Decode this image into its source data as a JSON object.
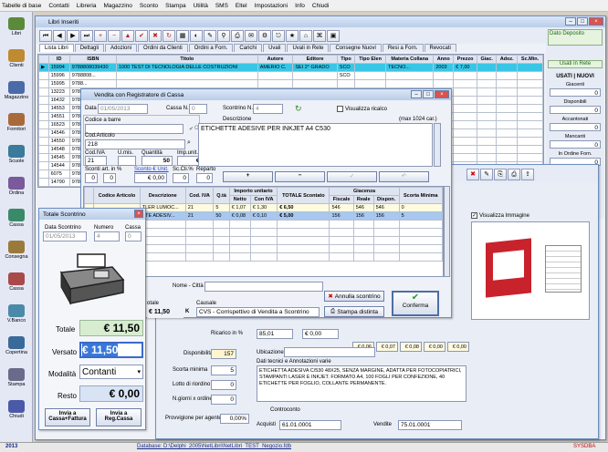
{
  "menu": [
    "Tabelle di base",
    "Contatti",
    "Libreria",
    "Magazzino",
    "Sconto",
    "Stampa",
    "Utilità",
    "SMS",
    "Eltel",
    "Impostazioni",
    "Info",
    "Chiudi"
  ],
  "sidebar": [
    "Libri",
    "Clienti",
    "Magazzino",
    "Fornitori",
    "Scuole",
    "Ordina",
    "Cassa",
    "Consegna",
    "Cassa",
    "V.Banco",
    "Copertina",
    "Stampa",
    "Chiudi"
  ],
  "status": {
    "year": "2013",
    "db": "Database: D:\\Delphi_2005\\NetLibri\\NetLibri_TEST_Negozio.fdb",
    "brand": "SYSDBA"
  },
  "libri": {
    "title": "Libri Inseriti",
    "tabs": [
      "Lista Libri",
      "Dettagli",
      "Adozioni",
      "Ordini da Clienti",
      "Ordini a Forn.",
      "Carichi",
      "Uvali",
      "Uvali in Rete",
      "Consegne Nuovi",
      "Resi a Forn.",
      "Revocati"
    ],
    "cols": [
      "ID",
      "ISBN",
      "Titolo",
      "Autore",
      "Editore",
      "Tipo",
      "Tipo Elen",
      "Materia Collana",
      "Anno",
      "Prezzo",
      "Giac.",
      "Adoz.",
      "Sc.Min."
    ],
    "subcols": [
      "U",
      "N",
      "A",
      "T",
      "U",
      "N",
      "T",
      "AH.",
      "M..."
    ],
    "rows": [
      {
        "id": "15994",
        "isbn": "9788808039430",
        "title": "1000 TEST DI TECNOLOGIA DELLE COSTRUZIONI",
        "author": "AMERIO C.",
        "ed": "SEI 2° GRADO",
        "tipo": "SCO",
        "mat": "TECNO...",
        "anno": "2003",
        "prezzo": "€ 7,00"
      },
      {
        "id": "15996",
        "isbn": "9788808...",
        "title": "",
        "author": "",
        "ed": "",
        "tipo": "SCO",
        "mat": "",
        "anno": "",
        "prezzo": ""
      },
      {
        "id": "15995",
        "isbn": "9788...",
        "title": "",
        "author": "",
        "ed": "",
        "tipo": "",
        "mat": "",
        "anno": "",
        "prezzo": ""
      },
      {
        "id": "13223",
        "isbn": "9788...",
        "title": "",
        "author": "",
        "ed": "",
        "tipo": "",
        "mat": "",
        "anno": "",
        "prezzo": ""
      },
      {
        "id": "16432",
        "isbn": "9788...",
        "title": "",
        "author": "",
        "ed": "",
        "tipo": "",
        "mat": "",
        "anno": "",
        "prezzo": ""
      },
      {
        "id": "14553",
        "isbn": "9788...",
        "title": "",
        "author": "",
        "ed": "",
        "tipo": "",
        "mat": "",
        "anno": "",
        "prezzo": ""
      },
      {
        "id": "14551",
        "isbn": "9788...",
        "title": "",
        "author": "",
        "ed": "",
        "tipo": "",
        "mat": "",
        "anno": "",
        "prezzo": ""
      },
      {
        "id": "16523",
        "isbn": "9788...",
        "title": "",
        "author": "",
        "ed": "",
        "tipo": "",
        "mat": "",
        "anno": "",
        "prezzo": ""
      },
      {
        "id": "14546",
        "isbn": "9788...",
        "title": "",
        "author": "",
        "ed": "",
        "tipo": "",
        "mat": "",
        "anno": "",
        "prezzo": ""
      },
      {
        "id": "14550",
        "isbn": "9788...",
        "title": "",
        "author": "",
        "ed": "",
        "tipo": "",
        "mat": "",
        "anno": "",
        "prezzo": ""
      },
      {
        "id": "14548",
        "isbn": "9788...",
        "title": "",
        "author": "",
        "ed": "",
        "tipo": "",
        "mat": "",
        "anno": "",
        "prezzo": ""
      },
      {
        "id": "14545",
        "isbn": "9788...",
        "title": "",
        "author": "",
        "ed": "",
        "tipo": "",
        "mat": "",
        "anno": "",
        "prezzo": ""
      },
      {
        "id": "14544",
        "isbn": "9788...",
        "title": "",
        "author": "",
        "ed": "",
        "tipo": "",
        "mat": "",
        "anno": "",
        "prezzo": ""
      },
      {
        "id": "6075",
        "isbn": "9788...",
        "title": "",
        "author": "",
        "ed": "",
        "tipo": "",
        "mat": "",
        "anno": "",
        "prezzo": ""
      },
      {
        "id": "14790",
        "isbn": "9788...",
        "title": "",
        "author": "",
        "ed": "",
        "tipo": "",
        "mat": "",
        "anno": "",
        "prezzo": ""
      },
      {
        "id": "14791",
        "isbn": "9788...",
        "title": "",
        "author": "",
        "ed": "",
        "tipo": "",
        "mat": "",
        "anno": "",
        "prezzo": ""
      },
      {
        "id": "14792",
        "isbn": "9788...",
        "title": "",
        "author": "",
        "ed": "",
        "tipo": "",
        "mat": "",
        "anno": "",
        "prezzo": ""
      }
    ]
  },
  "right": {
    "deposito": "Dato Deposito",
    "usati": "Usati in Rete",
    "usati_nuovi": "USATI | NUOVI",
    "giacenti": "Giacenti",
    "disponibili": "Disponibili",
    "accantonati": "Accantonati",
    "mancanti": "Mancanti",
    "in_ordine": "In Ordine Forn.",
    "zero": "0"
  },
  "vendita": {
    "title": "Vendita con Registratore di Cassa",
    "data_lbl": "Data",
    "data": "01/05/2013",
    "cassa_lbl": "Cassa N.",
    "cassa": "0",
    "scontrino_lbl": "Scontrino N.",
    "scontrino": "4",
    "visualizza": "Visualizza ricalco",
    "codice_lbl": "Codice a barre",
    "ok": "Ok",
    "desc_lbl": "Descrizione",
    "max": "(max 1024 car.)",
    "descrizione": "ETICHETTE ADESIVE PER INKJET A4 C530",
    "cod_art_lbl": "Cod.Articolo",
    "cod_art": "218",
    "cod_iva_lbl": "Cod.IVA",
    "cod_iva": "21",
    "um_lbl": "U.mis.",
    "qta_lbl": "Quantità",
    "qta": "50",
    "imp_lbl": "Imp.unit.con IVA",
    "imp": "€ 0,10",
    "sc_art_lbl": "Sconti art. in %",
    "sc1": "0",
    "sc2": "0",
    "sc_unit_lbl": "Sconto € Unit.",
    "sc_unit": "€ 0,00",
    "sc_cli_lbl": "Sc.Cli.%",
    "sc_cli": "0",
    "reparto_lbl": "Reparto",
    "reparto": "0",
    "grid_cols": [
      "Codice Articolo",
      "Descrizione",
      "Cod. IVA",
      "Q.tà",
      "Netto",
      "Con IVA",
      "TOTALE Scontato",
      "Fiscale",
      "Reale",
      "Dispon.",
      "Scorta Minima"
    ],
    "grid_groups": {
      "importo": "Importo unitario",
      "giacenza": "Giacenza"
    },
    "grid_rows": [
      {
        "code": "",
        "desc": "TLER LUMOC...",
        "iva": "21",
        "q": "5",
        "netto": "€ 1,07",
        "con": "€ 1,30",
        "tot": "€ 6,50",
        "fis": "546",
        "rea": "546",
        "dis": "546",
        "sm": "0"
      },
      {
        "code": "",
        "desc": "TTE ADESIV...",
        "iva": "21",
        "q": "50",
        "netto": "€ 0,08",
        "con": "€ 0,10",
        "tot": "€ 5,00",
        "fis": "156",
        "rea": "156",
        "dis": "156",
        "sm": "5"
      }
    ],
    "nome_lbl": "Nome - Città",
    "tot_lbl": "otale",
    "tot": "€ 11,50",
    "totk": "K",
    "causale_lbl": "Causale",
    "causale": "CVS - Corrispettivo di Vendita a Scontrino",
    "annulla": "Annulla scontrino",
    "stampa": "Stampa distinta",
    "conferma": "Conferma"
  },
  "scontrino": {
    "title": "Totale Scontrino",
    "data_lbl": "Data Scontrino",
    "data": "01/05/2013",
    "num_lbl": "Numero",
    "num": "4",
    "cassa_lbl": "Cassa",
    "cassa": "0",
    "totale_lbl": "Totale",
    "totale": "€ 11,50",
    "versato_lbl": "Versato",
    "versato": "€ 11,50",
    "modalita_lbl": "Modalità",
    "modalita": "Contanti",
    "resto_lbl": "Resto",
    "resto": "€ 0,00",
    "btn1": "Invia a Cassa+Fattura",
    "btn2": "Invia a Reg.Cassa"
  },
  "dettaglio": {
    "visualizza_img": "Visualizza Immagine",
    "ricarico_lbl": "Ricarico in %",
    "ricarico": "85,01",
    "ricarico2": "€ 0,00",
    "vals": [
      "€ 0,06",
      "€ 0,07",
      "€ 0,08",
      "€ 0,00",
      "€ 0,00"
    ],
    "disp_lbl": "Disponibilità",
    "disp": "157",
    "scorta_lbl": "Scorta minima",
    "scorta": "5",
    "lotto_lbl": "Lotto di riordino",
    "lotto": "0",
    "giorni_lbl": "N.giorni x ordine",
    "giorni": "0",
    "ubic_lbl": "Ubicazione",
    "dati_lbl": "Dati tecnici e Annotazioni varie",
    "dati": "ETICHETTA ADESIVA C/530 48X25, SENZA MARGINE, ADATTA PER FOTOCOPIATRICI, STAMPANTI LASER E INKJET. FORMATO A4, 100 FOGLI PER CONFEZIONE, 40 ETICHETTE PER FOGLIO, COLLANTE PERMANENTE.",
    "controconto": "Controconto",
    "acq_lbl": "Acquisti",
    "acq": "61.01.0001",
    "vend_lbl": "Vendite",
    "vend": "75.01.0001",
    "prov_lbl": "Provvigione per agente",
    "prov": "0,00%"
  }
}
